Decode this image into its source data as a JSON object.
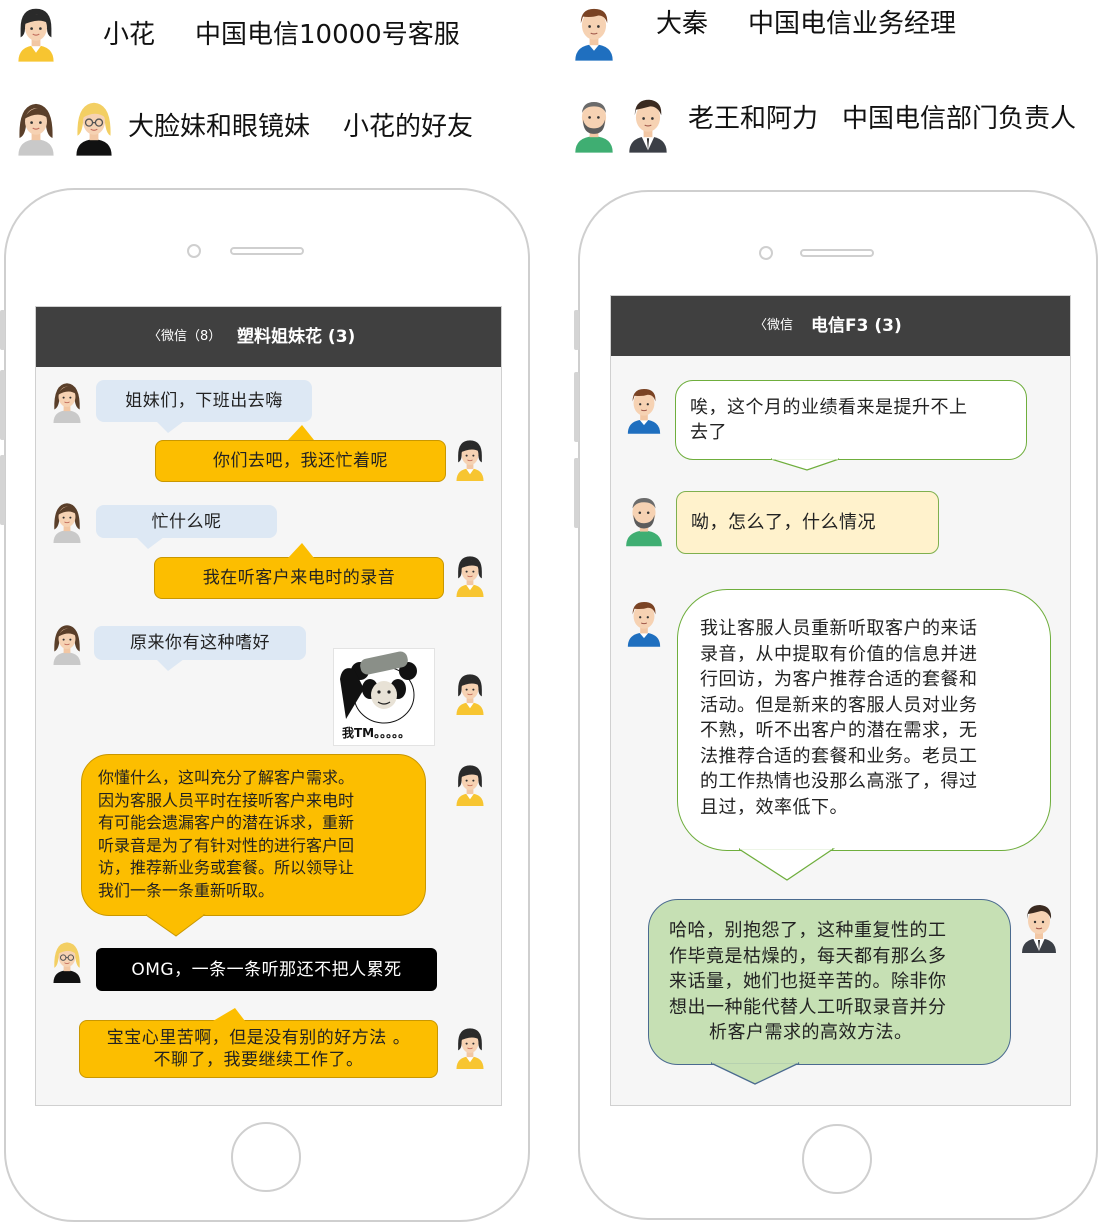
{
  "legend": {
    "xiaohua": {
      "name": "小花",
      "role": "中国电信10000号客服"
    },
    "daqin": {
      "name": "大秦",
      "role": "中国电信业务经理"
    },
    "friends": {
      "names": "大脸妹和眼镜妹",
      "role": "小花的好友"
    },
    "leaders": {
      "names": "老王和阿力",
      "role": "中国电信部门负责人"
    }
  },
  "left_chat": {
    "back_label": "〈微信（8）",
    "title": "塑料姐妹花 (3)",
    "messages": [
      {
        "sender": "大脸妹",
        "text": "姐妹们，下班出去嗨"
      },
      {
        "sender": "小花",
        "text": "你们去吧，我还忙着呢"
      },
      {
        "sender": "大脸妹",
        "text": "忙什么呢"
      },
      {
        "sender": "小花",
        "text": "我在听客户来电时的录音"
      },
      {
        "sender": "大脸妹",
        "text": "原来你有这种嗜好"
      },
      {
        "sender": "小花",
        "sticker_caption": "我TM。。。。。"
      },
      {
        "sender": "小花",
        "lines": [
          "你懂什么，这叫充分了解客户需求。",
          "因为客服人员平时在接听客户来电时",
          "有可能会遗漏客户的潜在诉求，重新",
          "听录音是为了有针对性的进行客户回",
          "访，推荐新业务或套餐。所以领导让",
          "我们一条一条重新听取。"
        ]
      },
      {
        "sender": "眼镜妹",
        "text": "OMG，一条一条听那还不把人累死"
      },
      {
        "sender": "小花",
        "lines": [
          "宝宝心里苦啊，但是没有别的好方法 。",
          "不聊了，我要继续工作了。"
        ]
      }
    ]
  },
  "right_chat": {
    "back_label": "〈微信",
    "title": "电信F3 (3)",
    "messages": [
      {
        "sender": "大秦",
        "lines": [
          "唉，这个月的业绩看来是提升不上",
          "去了"
        ]
      },
      {
        "sender": "老王",
        "text": "呦，怎么了，什么情况"
      },
      {
        "sender": "大秦",
        "lines": [
          "我让客服人员重新听取客户的来话",
          "录音，从中提取有价值的信息并进",
          "行回访，为客户推荐合适的套餐和",
          "活动。但是新来的客服人员对业务",
          "不熟，听不出客户的潜在需求，无",
          "法推荐合适的套餐和业务。老员工",
          "的工作热情也没那么高涨了，得过",
          "且过，效率低下。"
        ]
      },
      {
        "sender": "阿力",
        "lines": [
          "哈哈，别抱怨了，这种重复性的工",
          "作毕竟是枯燥的，每天都有那么多",
          "来话量，她们也挺辛苦的。除非你",
          "想出一种能代替人工听取录音并分",
          "析客户需求的高效方法。"
        ]
      }
    ]
  },
  "colors": {
    "titlebar": "#404040",
    "bubble_blue": "#dde8f4",
    "bubble_yellow": "#fcbe00",
    "bubble_green": "#c6e0b4",
    "bubble_cream": "#fff2cc"
  }
}
